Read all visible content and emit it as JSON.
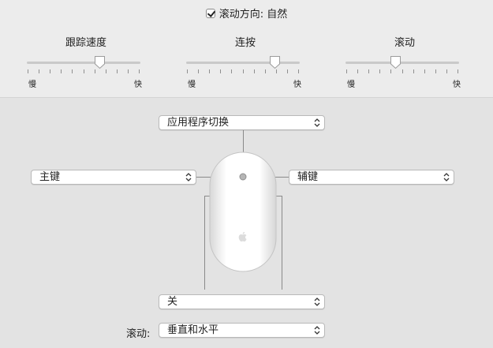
{
  "natural_scroll": {
    "label": "滚动方向: 自然",
    "checked": true
  },
  "sliders": [
    {
      "title": "跟踪速度",
      "min": "慢",
      "max": "快",
      "value": 0.64
    },
    {
      "title": "连按",
      "min": "慢",
      "max": "快",
      "value": 0.78
    },
    {
      "title": "滚动",
      "min": "慢",
      "max": "快",
      "value": 0.44
    }
  ],
  "buttons": {
    "top": "应用程序切换",
    "left": "主键",
    "right": "辅键",
    "side": "关"
  },
  "scroll": {
    "label": "滚动:",
    "value": "垂直和水平"
  }
}
